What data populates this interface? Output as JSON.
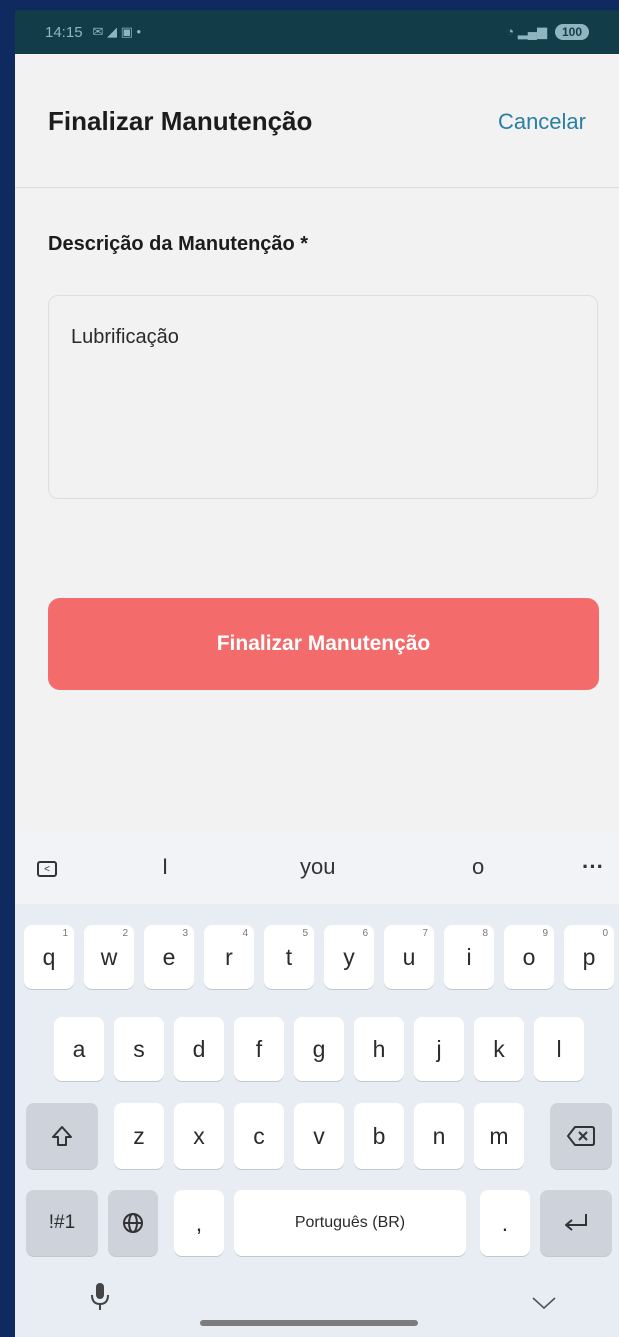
{
  "status_bar": {
    "time": "14:15",
    "battery": "100"
  },
  "header": {
    "title": "Finalizar Manutenção",
    "cancel_label": "Cancelar"
  },
  "form": {
    "description_label": "Descrição da Manutenção *",
    "description_value": "Lubrificação",
    "submit_label": "Finalizar Manutenção"
  },
  "colors": {
    "submit_button": "#f36c6b",
    "cancel_link": "#2a7fa3",
    "status_bar": "#123c48"
  },
  "keyboard": {
    "suggestions": [
      "I",
      "you",
      "o"
    ],
    "more_label": "···",
    "row1": [
      {
        "key": "q",
        "hint": "1"
      },
      {
        "key": "w",
        "hint": "2"
      },
      {
        "key": "e",
        "hint": "3"
      },
      {
        "key": "r",
        "hint": "4"
      },
      {
        "key": "t",
        "hint": "5"
      },
      {
        "key": "y",
        "hint": "6"
      },
      {
        "key": "u",
        "hint": "7"
      },
      {
        "key": "i",
        "hint": "8"
      },
      {
        "key": "o",
        "hint": "9"
      },
      {
        "key": "p",
        "hint": "0"
      }
    ],
    "row2": [
      "a",
      "s",
      "d",
      "f",
      "g",
      "h",
      "j",
      "k",
      "l"
    ],
    "row3": [
      "z",
      "x",
      "c",
      "v",
      "b",
      "n",
      "m"
    ],
    "symbols_label": "!#1",
    "comma_label": ",",
    "space_label": "Português (BR)",
    "period_label": ".",
    "icons": [
      "shift-icon",
      "backspace-icon",
      "globe-icon",
      "enter-icon",
      "microphone-icon",
      "hide-keyboard-icon"
    ]
  }
}
